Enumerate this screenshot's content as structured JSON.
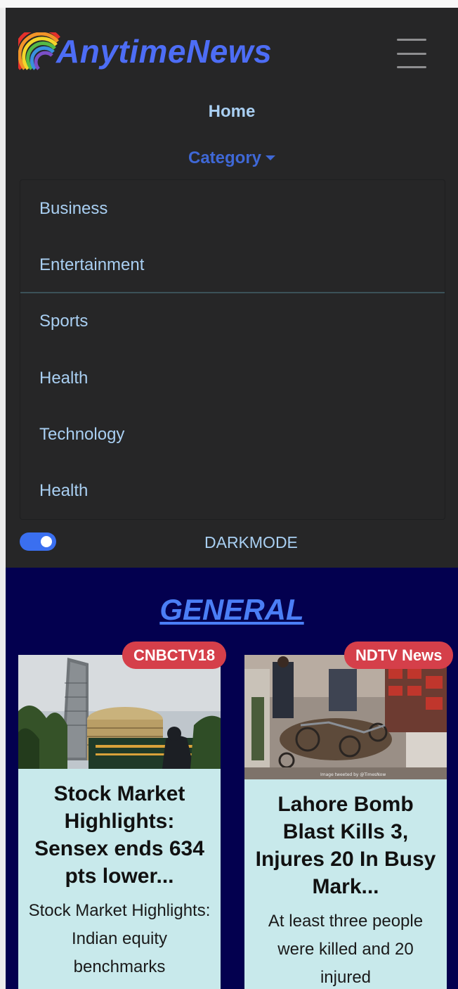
{
  "app": {
    "brand": "AnytimeNews"
  },
  "nav": {
    "home": "Home",
    "category": "Category",
    "dropdown_items": [
      "Business",
      "Entertainment",
      "Sports",
      "Health",
      "Technology",
      "Health"
    ]
  },
  "darkmode": {
    "label": "DARKMODE",
    "enabled": true
  },
  "section": {
    "title": "GENERAL"
  },
  "articles": [
    {
      "source": "CNBCTV18",
      "title": "Stock Market Highlights: Sensex ends 634 pts lower...",
      "description": "Stock Market Highlights: Indian equity benchmarks"
    },
    {
      "source": "NDTV News",
      "title": "Lahore Bomb Blast Kills 3, Injures 20 In Busy Mark...",
      "description": "At least three people were killed and 20 injured"
    }
  ],
  "colors": {
    "brand": "#4d6df5",
    "navbar_bg": "#262627",
    "main_bg": "#03004f",
    "badge": "#d53f4a",
    "card_bg": "#c8e9eb"
  }
}
